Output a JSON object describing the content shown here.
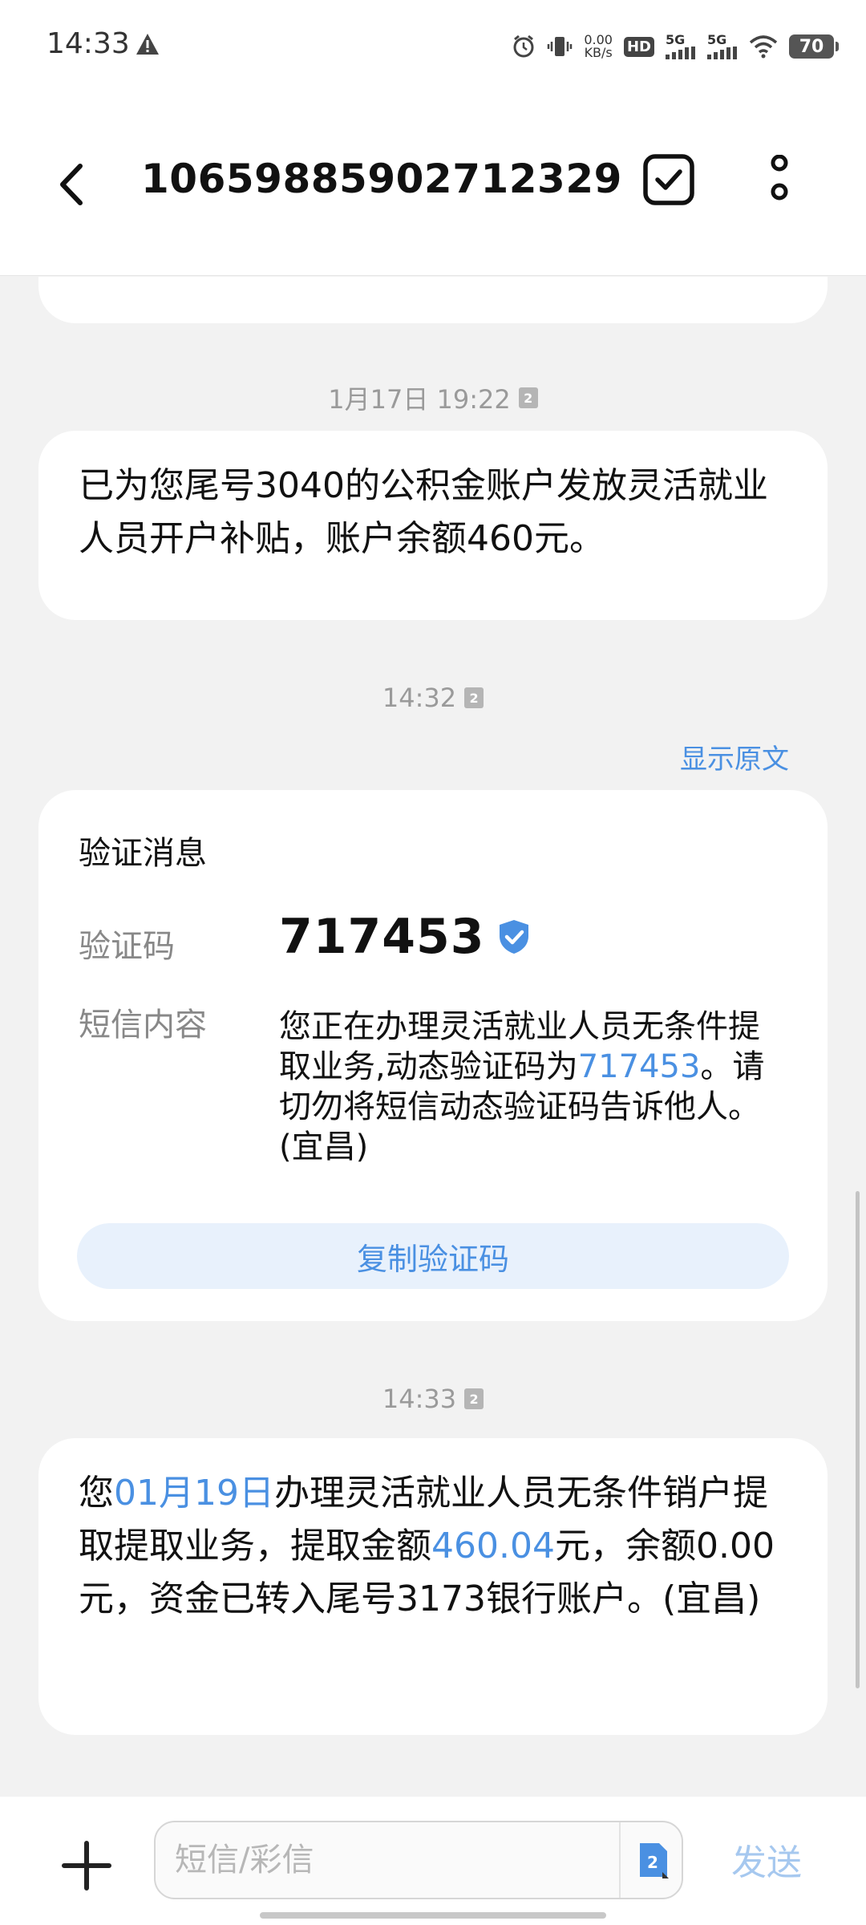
{
  "status_bar": {
    "time": "14:33",
    "speed_value": "0.00",
    "speed_unit": "KB/s",
    "hd": "HD",
    "net1": "5G",
    "net2": "5G",
    "battery": "70"
  },
  "header": {
    "title": "10659885902712329"
  },
  "messages": [
    {
      "timestamp": "1月17日 19:22",
      "sim": "2",
      "text": "已为您尾号3040的公积金账户发放灵活就业人员开户补贴，账户余额460元。"
    },
    {
      "timestamp": "14:32",
      "sim": "2",
      "show_original": "显示原文",
      "card_title": "验证消息",
      "code_label": "验证码",
      "code": "717453",
      "content_label": "短信内容",
      "content_before": "您正在办理灵活就业人员无条件提取业务,动态验证码为",
      "content_code": "717453",
      "content_after": "。请切勿将短信动态验证码告诉他人。(宜昌)",
      "copy_label": "复制验证码"
    },
    {
      "timestamp": "14:33",
      "sim": "2",
      "text_1": "您",
      "date_link": "01月19日",
      "text_2": "办理灵活就业人员无条件销户提取提取业务，提取金额",
      "amount_link": "460.04",
      "text_3": "元，余额0.00元，资金已转入尾号3173银行账户。(宜昌)"
    }
  ],
  "composer": {
    "placeholder": "短信/彩信",
    "sim": "2",
    "send_label": "发送"
  },
  "colors": {
    "accent": "#4a90e2",
    "background": "#f2f2f2",
    "bubble": "#ffffff",
    "send_disabled": "#a6c8ef"
  }
}
